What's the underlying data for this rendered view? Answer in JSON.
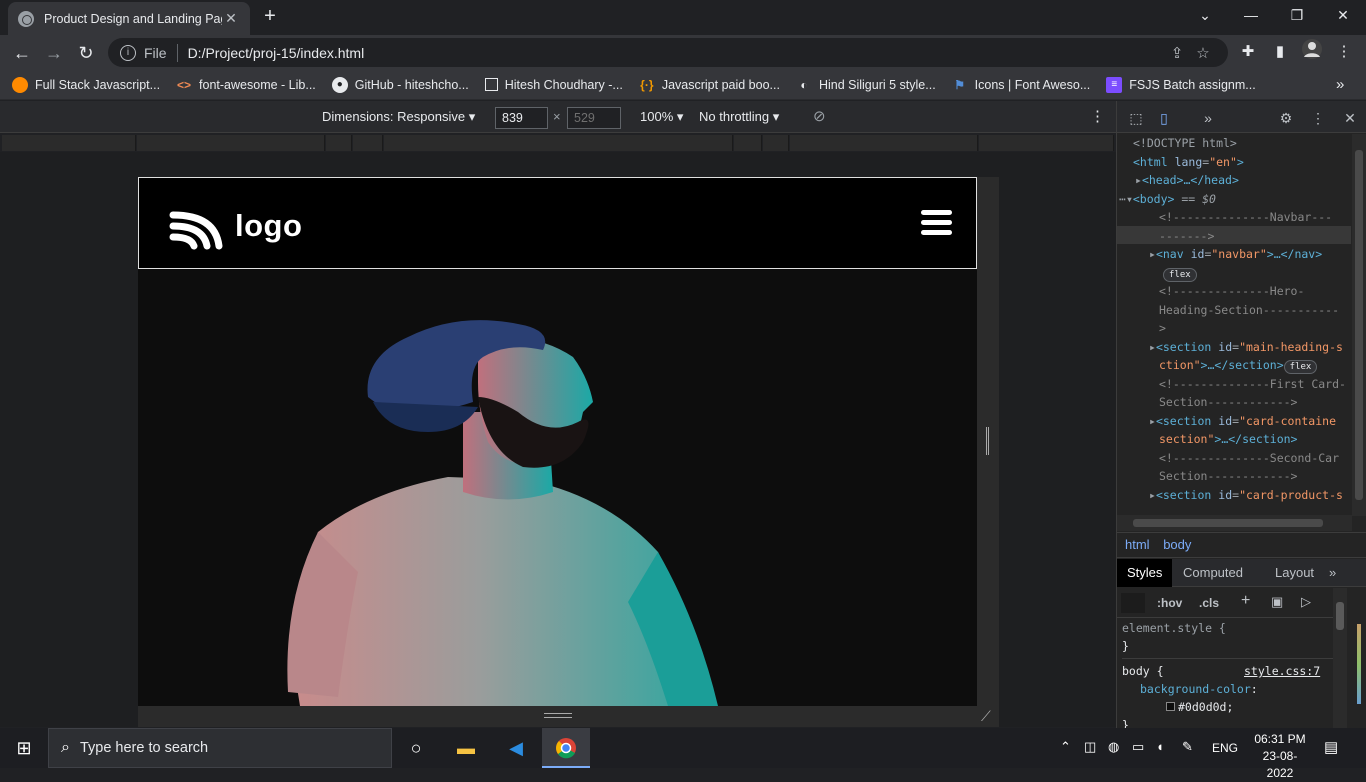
{
  "browser": {
    "tab_title": "Product Design and Landing Pag",
    "tab_close": "✕",
    "new_tab": "+",
    "window_controls": {
      "chevron": "⌄",
      "minimize": "—",
      "restore": "❐",
      "close": "✕"
    },
    "address": {
      "scheme_label": "File",
      "url": "D:/Project/proj-15/index.html"
    },
    "bookmarks": [
      {
        "label": "Full Stack Javascript...",
        "icon": "orange-circle-icon"
      },
      {
        "label": "font-awesome - Lib...",
        "icon": "code-brackets-icon"
      },
      {
        "label": "GitHub - hiteshcho...",
        "icon": "github-icon"
      },
      {
        "label": "Hitesh Choudhary -...",
        "icon": "checkbox-icon"
      },
      {
        "label": "Javascript paid boo...",
        "icon": "braces-icon"
      },
      {
        "label": "Hind Siliguri 5 style...",
        "icon": "google-fonts-icon"
      },
      {
        "label": "Icons | Font Aweso...",
        "icon": "flag-icon"
      },
      {
        "label": "FSJS Batch assignm...",
        "icon": "purple-list-icon"
      }
    ],
    "bookmarks_more": "»"
  },
  "device_toolbar": {
    "dimensions_label": "Dimensions: Responsive",
    "width_value": "839",
    "times": "×",
    "height_value": "529",
    "zoom": "100%",
    "throttling": "No throttling"
  },
  "site": {
    "logo_text": "logo",
    "colors": {
      "page_bg": "#0d0d0d",
      "nav_bg": "#000000",
      "nav_border": "#e0e0e0"
    }
  },
  "devtools": {
    "dom": {
      "doctype": "<!DOCTYPE html>",
      "html_open": "<html",
      "html_lang_attr": "lang",
      "html_lang_val": "\"en\"",
      "head": "<head>…</head>",
      "body": "<body>",
      "body_eq": " == $0",
      "c_navbar_1": "<!--------------Navbar---",
      "c_navbar_2": "------->",
      "nav_open": "<nav",
      "nav_attr": "id",
      "nav_val": "\"navbar\"",
      "nav_close": ">…</nav>",
      "badge_flex": "flex",
      "c_hero_1": "<!--------------Hero-",
      "c_hero_2": "Heading-Section-----------",
      "c_hero_3": ">",
      "sec1_open": "<section",
      "sec1_attr": "id",
      "sec1_val": "\"main-heading-s",
      "sec1_val2": "ction\"",
      "sec1_close": ">…</section>",
      "c_card_1": "<!--------------First Card-",
      "c_card_2": "Section------------>",
      "sec2_open": "<section",
      "sec2_attr": "id",
      "sec2_val": "\"card-containe",
      "sec2_val2": "section\"",
      "sec2_close": ">…</section>",
      "c_card2_1": "<!--------------Second-Car",
      "c_card2_2": "Section------------>",
      "sec3_open": "<section",
      "sec3_attr": "id",
      "sec3_val": "\"card-product-s"
    },
    "crumbs": [
      "html",
      "body"
    ],
    "style_tabs": [
      "Styles",
      "Computed",
      "Layout"
    ],
    "style_tabs_more": "»",
    "filter_hov": ":hov",
    "filter_cls": ".cls",
    "filter_add": "+",
    "styles": {
      "element_style": "element.style {",
      "close_brace": "}",
      "body_selector": "body {",
      "source": "style.css:7",
      "prop": "background-color",
      "value": "#0d0d0d;"
    }
  },
  "taskbar": {
    "search_placeholder": "Type here to search",
    "lang": "ENG",
    "time": "06:31 PM",
    "date": "23-08-2022"
  }
}
